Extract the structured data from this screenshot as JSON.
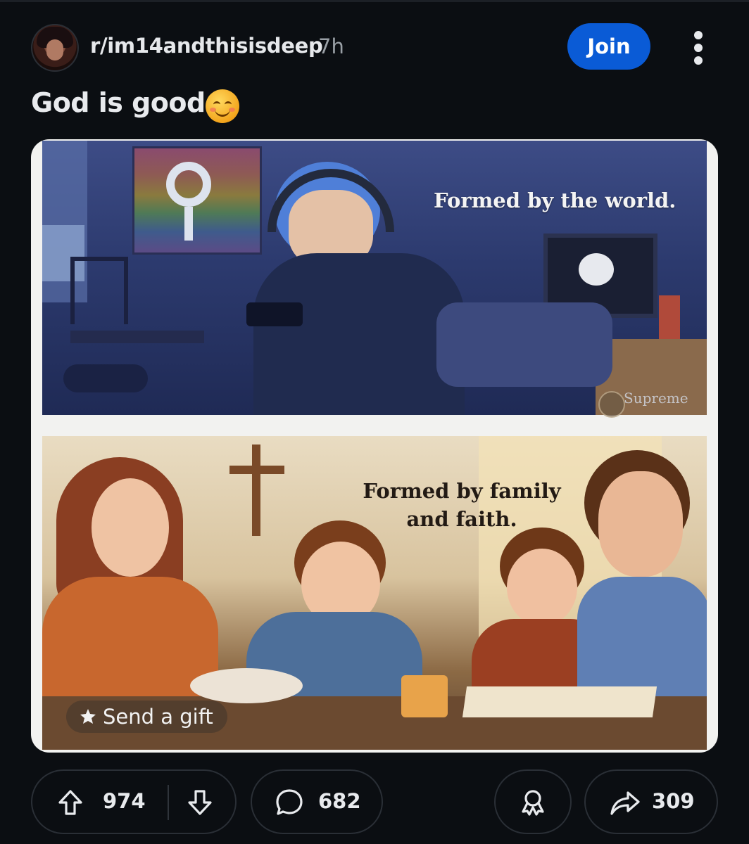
{
  "header": {
    "subreddit": "r/im14andthisisdeep",
    "time": "7h",
    "join_label": "Join"
  },
  "post": {
    "title": "God is good",
    "emoji": "smiling-face-with-smiling-eyes",
    "image": {
      "top_caption": "Formed by the world.",
      "bottom_caption_line1": "Formed by family",
      "bottom_caption_line2": "and faith.",
      "watermark": "Supreme",
      "gift_label": "Send a gift"
    }
  },
  "actions": {
    "upvotes": "974",
    "comments": "682",
    "shares": "309"
  },
  "colors": {
    "background": "#0b0e12",
    "join_button": "#0a5bd6",
    "pill_border": "#2a2f36"
  },
  "icons": [
    "avatar",
    "more-vertical-icon",
    "upvote-icon",
    "downvote-icon",
    "comment-icon",
    "award-icon",
    "share-icon",
    "gift-icon"
  ]
}
